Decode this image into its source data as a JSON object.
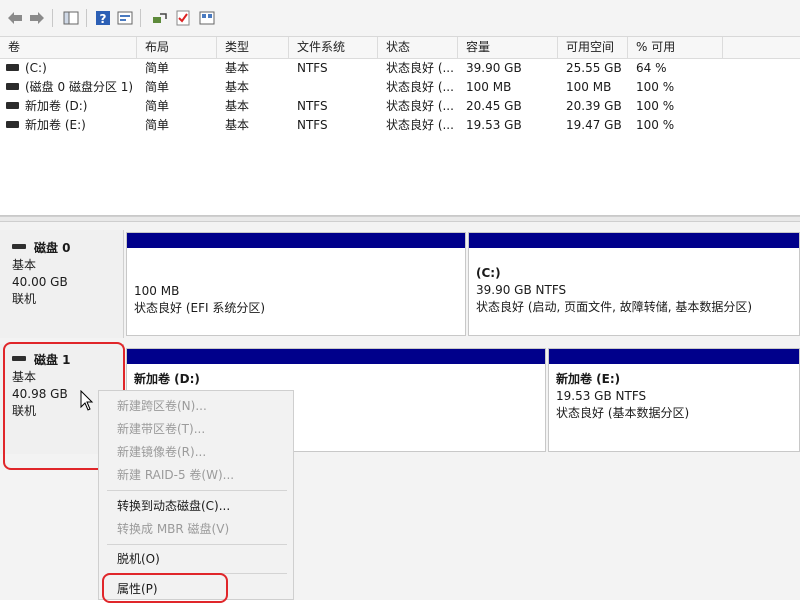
{
  "toolbar": {
    "buttons": [
      "back-icon",
      "forward-icon",
      "console-tree-icon",
      "help-icon",
      "properties-icon",
      "connect-icon",
      "check-icon",
      "view-icon"
    ]
  },
  "volume_list": {
    "columns": [
      "卷",
      "布局",
      "类型",
      "文件系统",
      "状态",
      "容量",
      "可用空间",
      "% 可用"
    ],
    "rows": [
      {
        "volume": "(C:)",
        "layout": "简单",
        "type": "基本",
        "fs": "NTFS",
        "status": "状态良好 (...",
        "capacity": "39.90 GB",
        "free": "25.55 GB",
        "pct": "64 %"
      },
      {
        "volume": "(磁盘 0 磁盘分区 1)",
        "layout": "简单",
        "type": "基本",
        "fs": "",
        "status": "状态良好 (...",
        "capacity": "100 MB",
        "free": "100 MB",
        "pct": "100 %"
      },
      {
        "volume": "新加卷 (D:)",
        "layout": "简单",
        "type": "基本",
        "fs": "NTFS",
        "status": "状态良好 (...",
        "capacity": "20.45 GB",
        "free": "20.39 GB",
        "pct": "100 %"
      },
      {
        "volume": "新加卷 (E:)",
        "layout": "简单",
        "type": "基本",
        "fs": "NTFS",
        "status": "状态良好 (...",
        "capacity": "19.53 GB",
        "free": "19.47 GB",
        "pct": "100 %"
      }
    ]
  },
  "disks": [
    {
      "name": "磁盘 0",
      "type": "基本",
      "size": "40.00 GB",
      "state": "联机",
      "partitions": [
        {
          "title": "",
          "line1": "100 MB",
          "line2": "状态良好 (EFI 系统分区)"
        },
        {
          "title": "(C:)",
          "line1": "39.90 GB NTFS",
          "line2": "状态良好 (启动, 页面文件, 故障转储, 基本数据分区)"
        }
      ]
    },
    {
      "name": "磁盘 1",
      "type": "基本",
      "size": "40.98 GB",
      "state": "联机",
      "partitions": [
        {
          "title": "新加卷 (D:)",
          "line1": "",
          "line2": ""
        },
        {
          "title": "新加卷 (E:)",
          "line1": "19.53 GB NTFS",
          "line2": "状态良好 (基本数据分区)"
        }
      ]
    }
  ],
  "context_menu": {
    "items": [
      {
        "label": "新建跨区卷(N)...",
        "disabled": true
      },
      {
        "label": "新建带区卷(T)...",
        "disabled": true
      },
      {
        "label": "新建镜像卷(R)...",
        "disabled": true
      },
      {
        "label": "新建 RAID-5 卷(W)...",
        "disabled": true
      },
      {
        "label": "转换到动态磁盘(C)...",
        "disabled": false
      },
      {
        "label": "转换成 MBR 磁盘(V)",
        "disabled": true
      },
      {
        "label": "脱机(O)",
        "disabled": false
      },
      {
        "label": "属性(P)",
        "disabled": false
      }
    ]
  },
  "colors": {
    "partition_bar": "#00008b",
    "highlight": "#e0262a"
  }
}
